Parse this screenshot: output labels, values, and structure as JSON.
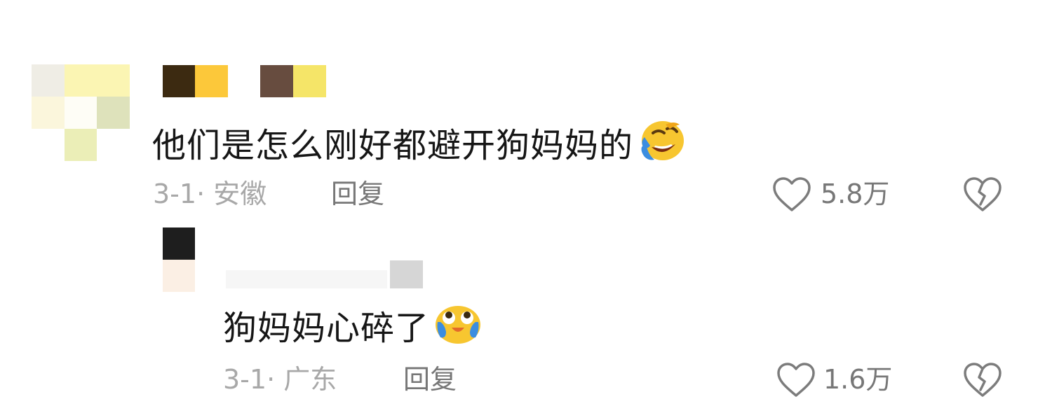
{
  "comments": [
    {
      "text": "他们是怎么刚好都避开狗妈妈的",
      "emoji": "rolling-laughing-emoji",
      "date": "3-1",
      "separator": "·",
      "location": "安徽",
      "reply_label": "回复",
      "likes": "5.8万"
    }
  ],
  "replies": [
    {
      "text": "狗妈妈心碎了",
      "emoji": "crying-face-emoji",
      "date": "3-1",
      "separator": "·",
      "location": "广东",
      "reply_label": "回复",
      "likes": "1.6万"
    }
  ],
  "colors": {
    "text": "#161616",
    "meta": "#a8a8a8",
    "action": "#777777",
    "emoji_yellow": "#f7c630"
  }
}
